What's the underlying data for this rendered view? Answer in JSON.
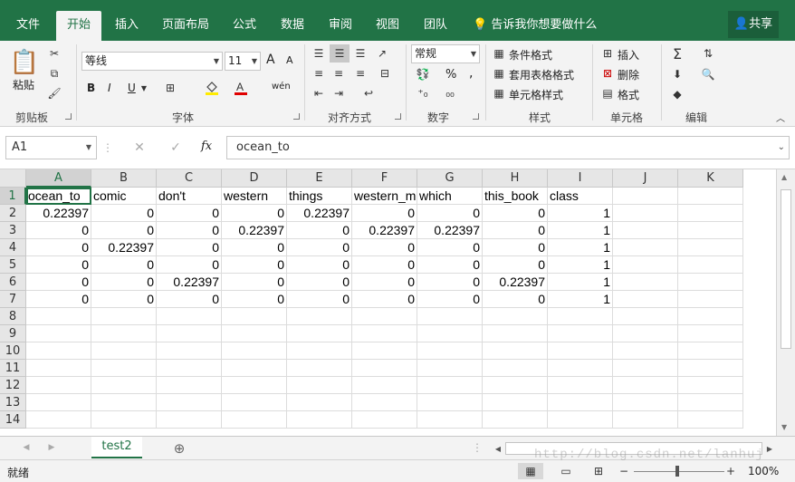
{
  "tabs": [
    "文件",
    "开始",
    "插入",
    "页面布局",
    "公式",
    "数据",
    "审阅",
    "视图",
    "团队"
  ],
  "tell_me": "告诉我你想要做什么",
  "share": "共享",
  "ribbon": {
    "clipboard": {
      "paste": "粘贴",
      "label": "剪贴板"
    },
    "font": {
      "name": "等线",
      "size": "11",
      "label": "字体",
      "bold": "B",
      "italic": "I",
      "underline": "U",
      "grow": "A",
      "shrink": "A",
      "wen": "wén"
    },
    "alignment": {
      "label": "对齐方式"
    },
    "number": {
      "format": "常规",
      "label": "数字",
      "percent": "%",
      "comma": ","
    },
    "styles": {
      "cond": "条件格式",
      "table": "套用表格格式",
      "cell": "单元格样式",
      "label": "样式"
    },
    "cells": {
      "insert": "插入",
      "delete": "删除",
      "format": "格式",
      "label": "单元格"
    },
    "editing": {
      "label": "编辑"
    }
  },
  "formula_bar": {
    "name_box": "A1",
    "fx": "fx",
    "value": "ocean_to"
  },
  "columns": [
    "A",
    "B",
    "C",
    "D",
    "E",
    "F",
    "G",
    "H",
    "I",
    "J",
    "K"
  ],
  "rows": [
    "1",
    "2",
    "3",
    "4",
    "5",
    "6",
    "7",
    "8",
    "9",
    "10",
    "11",
    "12",
    "13",
    "14"
  ],
  "cells": [
    [
      "ocean_to",
      "comic",
      "don't",
      "western",
      "things",
      "western_m",
      "which",
      "this_book",
      "class"
    ],
    [
      "0.22397",
      "0",
      "0",
      "0",
      "0.22397",
      "0",
      "0",
      "0",
      "1"
    ],
    [
      "0",
      "0",
      "0",
      "0.22397",
      "0",
      "0.22397",
      "0.22397",
      "0",
      "1"
    ],
    [
      "0",
      "0.22397",
      "0",
      "0",
      "0",
      "0",
      "0",
      "0",
      "1"
    ],
    [
      "0",
      "0",
      "0",
      "0",
      "0",
      "0",
      "0",
      "0",
      "1"
    ],
    [
      "0",
      "0",
      "0.22397",
      "0",
      "0",
      "0",
      "0",
      "0.22397",
      "1"
    ],
    [
      "0",
      "0",
      "0",
      "0",
      "0",
      "0",
      "0",
      "0",
      "1"
    ]
  ],
  "sheet_tab": "test2",
  "status": {
    "ready": "就绪",
    "zoom": "100%"
  },
  "watermark": "http://blog.csdn.net/lanhuj"
}
